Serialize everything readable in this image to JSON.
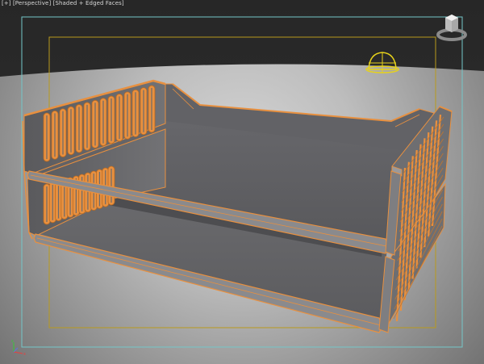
{
  "viewport": {
    "label_menu": "[+]",
    "label_view": "[Perspective]",
    "label_shading": "[Shaded + Edged Faces]"
  },
  "colors": {
    "background_top": "#2b2b2b",
    "ground_light": "#d2d2d2",
    "ground_dark": "#6e6e6e",
    "tray_gray": "#5e5e60",
    "selection_orange": "#e8903f",
    "safe_frame_cyan": "#74c7c9",
    "safe_frame_yellow": "#b99a1c",
    "light_gizmo": "#e7d21a"
  },
  "icons": [
    "viewcube-icon",
    "light-gizmo-icon",
    "axis-tripod-icon"
  ],
  "model": {
    "name": "desk-tray",
    "tiers": 2,
    "state": "selected"
  }
}
